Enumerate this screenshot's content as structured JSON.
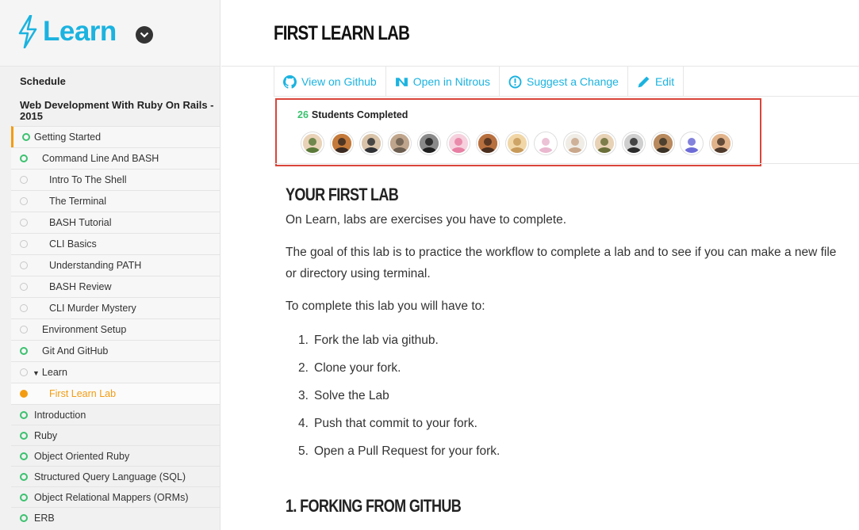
{
  "app": {
    "logo_text": "Learn",
    "logo_color": "#1bb3e0"
  },
  "sidebar": {
    "schedule_label": "Schedule",
    "course_title": "Web Development With Ruby On Rails - 2015",
    "items": [
      {
        "label": "Getting Started",
        "status": "complete"
      },
      {
        "label": "Command Line And BASH",
        "status": "complete"
      },
      {
        "label": "Intro To The Shell",
        "status": "incomplete"
      },
      {
        "label": "The Terminal",
        "status": "incomplete"
      },
      {
        "label": "BASH Tutorial",
        "status": "incomplete"
      },
      {
        "label": "CLI Basics",
        "status": "incomplete"
      },
      {
        "label": "Understanding PATH",
        "status": "incomplete"
      },
      {
        "label": "BASH Review",
        "status": "incomplete"
      },
      {
        "label": "CLI Murder Mystery",
        "status": "incomplete"
      },
      {
        "label": "Environment Setup",
        "status": "incomplete"
      },
      {
        "label": "Git And GitHub",
        "status": "complete"
      },
      {
        "label": "Learn",
        "status": "incomplete"
      },
      {
        "label": "First Learn Lab",
        "status": "current"
      },
      {
        "label": "Introduction",
        "status": "complete"
      },
      {
        "label": "Ruby",
        "status": "complete"
      },
      {
        "label": "Object Oriented Ruby",
        "status": "complete"
      },
      {
        "label": "Structured Query Language (SQL)",
        "status": "complete"
      },
      {
        "label": "Object Relational Mappers (ORMs)",
        "status": "complete"
      },
      {
        "label": "ERB",
        "status": "complete"
      }
    ]
  },
  "lesson": {
    "title": "FIRST LEARN LAB",
    "actions": [
      {
        "label": "View on Github",
        "icon": "github-icon"
      },
      {
        "label": "Open in Nitrous",
        "icon": "nitrous-icon"
      },
      {
        "label": "Suggest a Change",
        "icon": "info-icon"
      },
      {
        "label": "Edit",
        "icon": "pencil-icon"
      }
    ],
    "completed": {
      "count": "26",
      "label": "Students Completed",
      "avatar_count": 15
    }
  },
  "content": {
    "heading1": "YOUR FIRST LAB",
    "p1": "On Learn, labs are exercises you have to complete.",
    "p2": "The goal of this lab is to practice the workflow to complete a lab and to see if you can make a new file or directory using terminal.",
    "p3": "To complete this lab you will have to:",
    "steps": [
      {
        "num": "1.",
        "text": "Fork the lab via github."
      },
      {
        "num": "2.",
        "text": "Clone your fork."
      },
      {
        "num": "3.",
        "text": "Solve the Lab"
      },
      {
        "num": "4.",
        "text": "Push that commit to your fork."
      },
      {
        "num": "5.",
        "text": "Open a Pull Request for your fork."
      }
    ],
    "heading2": "1. FORKING FROM GITHUB"
  },
  "colors": {
    "accent_blue": "#1bb3e0",
    "complete_green": "#3bc16f",
    "current_orange": "#f39c12",
    "highlight_red": "#d9453a"
  }
}
